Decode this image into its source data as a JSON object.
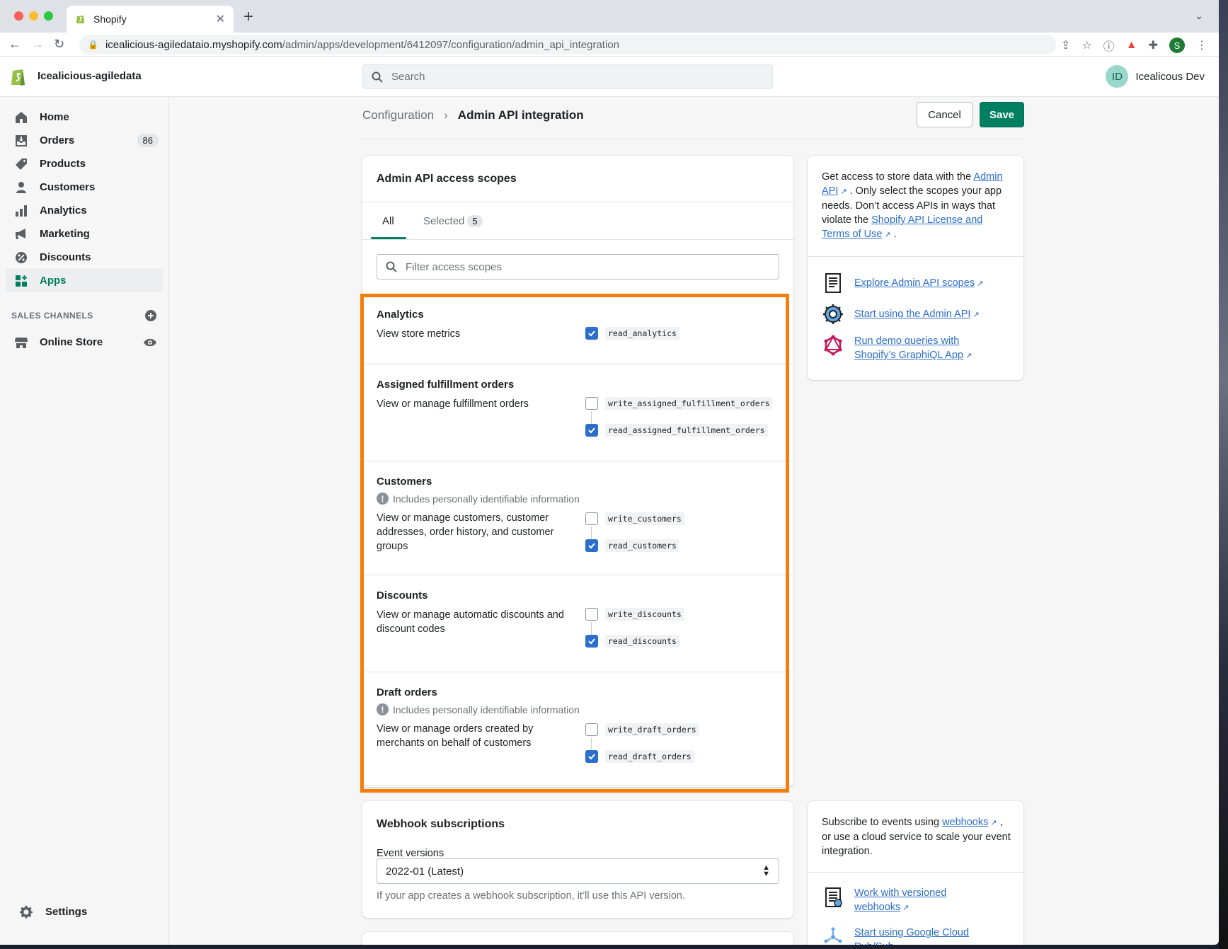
{
  "browser": {
    "tab_title": "Shopify",
    "url_host": "icealicious-agiledataio.myshopify.com",
    "url_path": "/admin/apps/development/6412097/configuration/admin_api_integration",
    "profile_initial": "S"
  },
  "topbar": {
    "store_name": "Icealicious-agiledata",
    "search_placeholder": "Search",
    "user_initials": "ID",
    "user_name": "Icealicous Dev"
  },
  "sidebar": {
    "items": [
      {
        "label": "Home",
        "icon": "home-icon"
      },
      {
        "label": "Orders",
        "icon": "orders-icon",
        "badge": "86"
      },
      {
        "label": "Products",
        "icon": "tag-icon"
      },
      {
        "label": "Customers",
        "icon": "person-icon"
      },
      {
        "label": "Analytics",
        "icon": "bar-chart-icon"
      },
      {
        "label": "Marketing",
        "icon": "megaphone-icon"
      },
      {
        "label": "Discounts",
        "icon": "discount-icon"
      },
      {
        "label": "Apps",
        "icon": "apps-icon",
        "active": true
      }
    ],
    "sales_channels_label": "SALES CHANNELS",
    "online_store_label": "Online Store",
    "settings_label": "Settings"
  },
  "header": {
    "breadcrumb_parent": "Configuration",
    "page_title": "Admin API integration",
    "cancel_label": "Cancel",
    "save_label": "Save"
  },
  "scopes_card": {
    "title": "Admin API access scopes",
    "tab_all": "All",
    "tab_selected": "Selected",
    "selected_count": "5",
    "filter_placeholder": "Filter access scopes",
    "pii_text": "Includes personally identifiable information",
    "groups": [
      {
        "title": "Analytics",
        "desc": "View store metrics",
        "scopes": [
          {
            "name": "read_analytics",
            "checked": true
          }
        ]
      },
      {
        "title": "Assigned fulfillment orders",
        "desc": "View or manage fulfillment orders",
        "scopes": [
          {
            "name": "write_assigned_fulfillment_orders",
            "checked": false
          },
          {
            "name": "read_assigned_fulfillment_orders",
            "checked": true
          }
        ]
      },
      {
        "title": "Customers",
        "pii": true,
        "desc": "View or manage customers, customer addresses, order history, and customer groups",
        "scopes": [
          {
            "name": "write_customers",
            "checked": false
          },
          {
            "name": "read_customers",
            "checked": true
          }
        ]
      },
      {
        "title": "Discounts",
        "desc": "View or manage automatic discounts and discount codes",
        "scopes": [
          {
            "name": "write_discounts",
            "checked": false
          },
          {
            "name": "read_discounts",
            "checked": true
          }
        ]
      },
      {
        "title": "Draft orders",
        "pii": true,
        "desc": "View or manage orders created by merchants on behalf of customers",
        "scopes": [
          {
            "name": "write_draft_orders",
            "checked": false
          },
          {
            "name": "read_draft_orders",
            "checked": true
          }
        ]
      }
    ]
  },
  "side_card": {
    "intro_1": "Get access to store data with the ",
    "admin_api_link": "Admin API",
    "intro_2": " . Only select the scopes your app needs. Don’t access APIs in ways that violate the ",
    "license_link": "Shopify API License and Terms of Use",
    "intro_3": " .",
    "links": [
      {
        "label": "Explore Admin API scopes",
        "icon": "document-icon"
      },
      {
        "label": "Start using the Admin API",
        "icon": "gear-icon"
      },
      {
        "label": "Run demo queries with Shopify’s GraphiQL App",
        "icon": "graphql-icon"
      }
    ]
  },
  "webhook_card": {
    "title": "Webhook subscriptions",
    "event_versions_label": "Event versions",
    "selected_version": "2022-01 (Latest)",
    "help_text": "If your app creates a webhook subscription, it’ll use this API version."
  },
  "side_card2": {
    "text_1": "Subscribe to events using ",
    "webhooks_link": "webhooks",
    "text_2": " , or use a cloud service to scale your event integration.",
    "links": [
      {
        "label": "Work with versioned webhooks",
        "icon": "document-icon"
      },
      {
        "label": "Start using Google Cloud Pub/Sub",
        "icon": "cloud-icon"
      }
    ]
  },
  "colors": {
    "primary_green": "#008060",
    "checkbox_blue": "#2c6ecb",
    "highlight_orange": "#f57e0b"
  }
}
